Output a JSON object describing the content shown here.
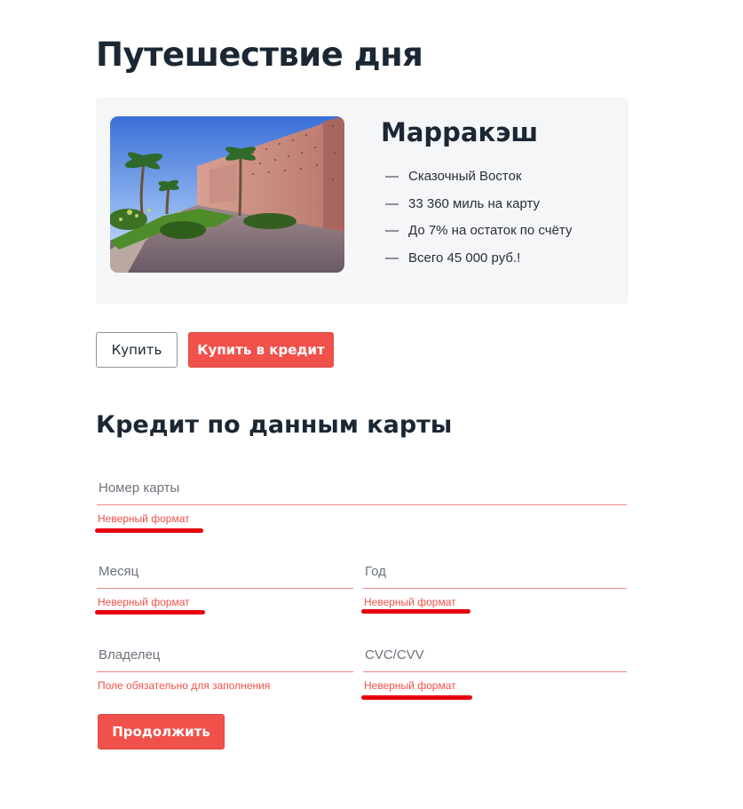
{
  "page": {
    "title": "Путешествие дня"
  },
  "offer": {
    "city": "Марракэш",
    "features": [
      "Сказочный Восток",
      "33 360 миль на карту",
      "До 7% на остаток по счёту",
      "Всего 45 000 руб.!"
    ],
    "dash": "—"
  },
  "actions": {
    "buy_label": "Купить",
    "buy_credit_label": "Купить в кредит"
  },
  "form": {
    "title": "Кредит по данным карты",
    "card_number": {
      "placeholder": "Номер карты",
      "value": "",
      "error": "Неверный формат"
    },
    "month": {
      "placeholder": "Месяц",
      "value": "",
      "error": "Неверный формат"
    },
    "year": {
      "placeholder": "Год",
      "value": "",
      "error": "Неверный формат"
    },
    "owner": {
      "placeholder": "Владелец",
      "value": "",
      "error": "Поле обязательно для заполнения"
    },
    "cvc": {
      "placeholder": "CVC/CVV",
      "value": "",
      "error": "Неверный формат"
    },
    "submit_label": "Продолжить"
  },
  "colors": {
    "accent": "#f0514a",
    "error": "#f0514a",
    "highlight": "#e8000b",
    "card_bg": "#f5f6f8"
  }
}
